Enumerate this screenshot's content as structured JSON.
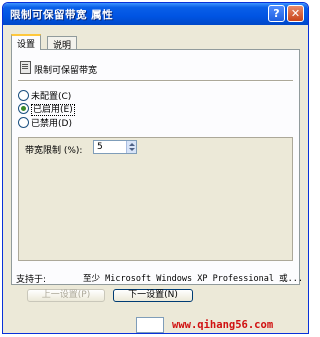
{
  "window": {
    "title": "限制可保留带宽 属性",
    "help_symbol": "?",
    "close_symbol": "✕"
  },
  "tabs": [
    {
      "label": "设置",
      "active": true
    },
    {
      "label": "说明",
      "active": false
    }
  ],
  "policy": {
    "name": "限制可保留带宽"
  },
  "options": [
    {
      "label": "未配置(C)",
      "selected": false
    },
    {
      "label": "已启用(E)",
      "selected": true
    },
    {
      "label": "已禁用(D)",
      "selected": false
    }
  ],
  "bandwidth": {
    "label": "带宽限制 (%):",
    "value": "5"
  },
  "support": {
    "label": "支持于:",
    "value": "至少 Microsoft Windows XP Professional 或..."
  },
  "buttons": {
    "prev": "上一设置(P)",
    "next": "下一设置(N)"
  },
  "watermark": "www.qihang56.com",
  "colors": {
    "titlebar": "#0054e3",
    "dialog_bg": "#ece9d8",
    "watermark": "#d01010"
  }
}
